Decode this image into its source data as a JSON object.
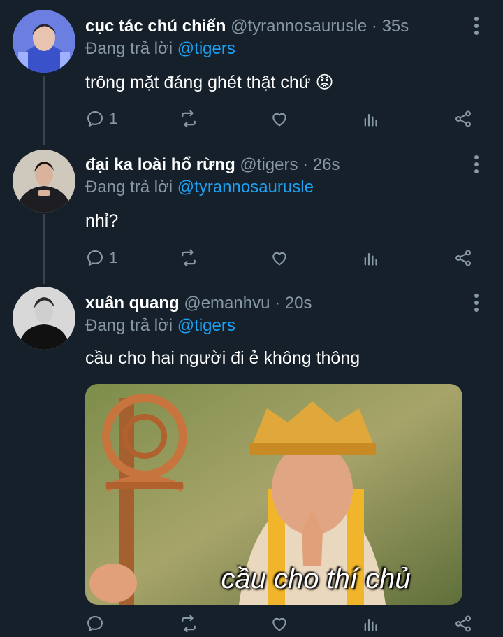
{
  "tweets": [
    {
      "name": "cục tác chú chiến",
      "handle": "@tyrannosaurusle",
      "time": "35s",
      "replying_label": "Đang trả lời",
      "reply_to": "@tigers",
      "text": "trông mặt đáng ghét thật chứ 😡",
      "reply_count": "1"
    },
    {
      "name": "đại ka loài hổ rừng",
      "handle": "@tigers",
      "time": "26s",
      "replying_label": "Đang trả lời",
      "reply_to": "@tyrannosaurusle",
      "text": "nhỉ?",
      "reply_count": "1"
    },
    {
      "name": "xuân quang",
      "handle": "@emanhvu",
      "time": "20s",
      "replying_label": "Đang trả lời",
      "reply_to": "@tigers",
      "text": "cầu cho hai người đi ẻ không thông",
      "reply_count": "",
      "media_caption": "cầu cho thí chủ"
    }
  ],
  "separator": "·",
  "icons": [
    "reply-icon",
    "retweet-icon",
    "like-icon",
    "analytics-icon",
    "share-icon",
    "more-icon"
  ],
  "colors": {
    "background": "#15202b",
    "secondary_text": "#8899a6",
    "link": "#1da1f2",
    "thread_line": "#38444d"
  }
}
